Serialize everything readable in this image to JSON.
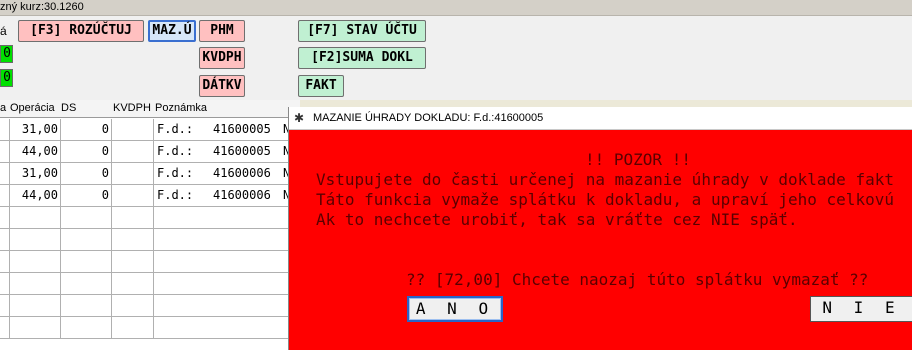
{
  "topbar": {
    "label": "zný kurz:30.1260"
  },
  "toolbar": {
    "left_label": "á",
    "green_fields": [
      "0",
      "0"
    ],
    "buttons": {
      "rozuctuj": "[F3] ROZÚČTUJ",
      "mazu": "MAZ.Ú",
      "phm": "PHM",
      "kvdph": "KVDPH",
      "datkv": "DÁTKV",
      "stav_uctu": "[F7] STAV ÚČTU",
      "suma_dokl": "[F2]SUMA DOKL",
      "fakt": "FAKT"
    }
  },
  "grid": {
    "headers": [
      "a",
      "Operácia",
      "DS",
      "KVDPH",
      "Poznámka"
    ],
    "rows": [
      {
        "operacia": "31,00",
        "ds": "0",
        "kvdph": "",
        "typ": "F.d.:",
        "cislo": "41600005",
        "extra": "N"
      },
      {
        "operacia": "44,00",
        "ds": "0",
        "kvdph": "",
        "typ": "F.d.:",
        "cislo": "41600005",
        "extra": "N"
      },
      {
        "operacia": "31,00",
        "ds": "0",
        "kvdph": "",
        "typ": "F.d.:",
        "cislo": "41600006",
        "extra": "N"
      },
      {
        "operacia": "44,00",
        "ds": "0",
        "kvdph": "",
        "typ": "F.d.:",
        "cislo": "41600006",
        "extra": "N"
      }
    ]
  },
  "dialog": {
    "title": "MAZANIE ÚHRADY DOKLADU: F.d.:41600005",
    "warning_title": "!! POZOR !!",
    "line1": "Vstupujete do časti určenej na mazanie úhrady v doklade fakt",
    "line2": "Táto funkcia vymaže splátku k dokladu, a upraví jeho celkovú",
    "line3": "Ak to nechcete urobiť, tak sa vráťte cez NIE späť.",
    "question": "?? [72,00] Chcete naozaj túto splátku vymazať ??",
    "yes_label": "A N O",
    "no_label": "N I E",
    "colors": {
      "background": "#ff0000",
      "text": "#5a0000"
    }
  }
}
